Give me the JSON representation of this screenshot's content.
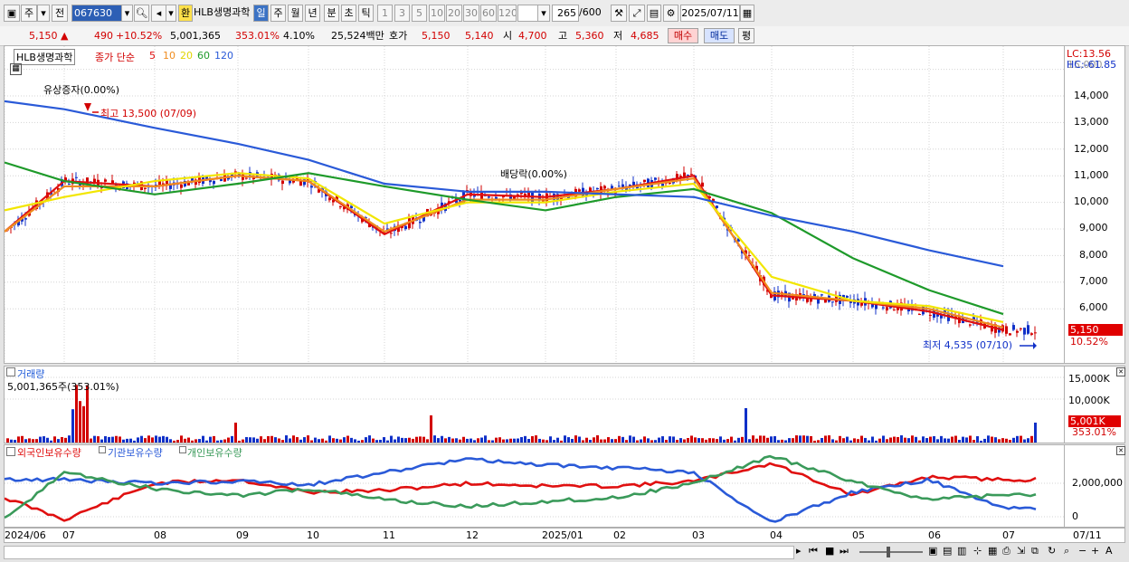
{
  "toolbar": {
    "period_tabs": [
      "주",
      "전"
    ],
    "stock_code": "067630",
    "exchange_badge": "환",
    "stock_name": "HLB생명과학",
    "interval_tabs": [
      "일",
      "주",
      "월",
      "년",
      "분",
      "초",
      "틱"
    ],
    "active_interval": "일",
    "minute_options": [
      "1",
      "3",
      "5",
      "10",
      "20",
      "30",
      "60",
      "120"
    ],
    "count": "265",
    "count_max": "/600",
    "date": "2025/07/11"
  },
  "quote": {
    "price": "5,150",
    "change": "490",
    "change_pct": "+10.52%",
    "volume": "5,001,365",
    "volume_ratio": "353.01%",
    "turnover": "4.10%",
    "amount": "25,524백만",
    "bid_label": "호가",
    "ask": "5,150",
    "bid": "5,140",
    "open_label": "시",
    "open": "4,700",
    "high_label": "고",
    "high": "5,360",
    "low_label": "저",
    "low": "4,685",
    "buy_label": "매수",
    "sell_label": "매도",
    "avg_label": "평"
  },
  "price_panel": {
    "legend_name": "HLB생명과학",
    "legend_type": "종가 단순",
    "ma_labels": [
      "5",
      "10",
      "20",
      "60",
      "120"
    ],
    "lc_label": "LC:13.56",
    "hc_label": "HC:-61.85",
    "y_ticks": [
      "14,000",
      "13,000",
      "12,000",
      "11,000",
      "10,000",
      "9,000",
      "8,000",
      "7,000",
      "6,000"
    ],
    "y_top_tick": "15,000",
    "current_price_tag": "5,150",
    "current_pct_tag": "10.52%",
    "annot_rights": "유상증자(0.00%)",
    "annot_high": "최고 13,500 (07/09)",
    "annot_dividend": "배당락(0.00%)",
    "annot_low": "최저 4,535 (07/10)"
  },
  "volume_panel": {
    "title": "거래량",
    "value_line": "5,001,365주(353.01%)",
    "y_ticks": [
      "15,000K",
      "10,000K"
    ],
    "current_tag": "5,001K",
    "current_pct": "353.01%"
  },
  "investor_panel": {
    "legend": [
      "외국인보유수량",
      "기관보유수량",
      "개인보유수량"
    ],
    "y_ticks": [
      "2,000,000",
      "0"
    ]
  },
  "x_axis": {
    "labels": [
      "2024/06",
      "07",
      "08",
      "09",
      "10",
      "11",
      "12",
      "2025/01",
      "02",
      "03",
      "04",
      "05",
      "06",
      "07"
    ],
    "right_label": "07/11"
  },
  "colors": {
    "up": "#d20000",
    "down": "#1030c8",
    "ma5": "#e01010",
    "ma10": "#f08c1e",
    "ma20": "#f2e600",
    "ma60": "#1e9a2a",
    "ma120": "#2a5ad8",
    "foreign": "#e01010",
    "institution": "#2a5ad8",
    "individual": "#3a9a5a"
  },
  "chart_data": {
    "type": "line",
    "title": "HLB생명과학",
    "x": [
      "2024/06",
      "07",
      "08",
      "09",
      "10",
      "11",
      "12",
      "2025/01",
      "02",
      "03",
      "04",
      "05",
      "06",
      "07"
    ],
    "ylim": [
      4500,
      15000
    ],
    "series": [
      {
        "name": "5",
        "values": [
          8900,
          10800,
          10600,
          11000,
          10800,
          8800,
          10300,
          10200,
          10500,
          11000,
          6500,
          6300,
          5900,
          5200
        ]
      },
      {
        "name": "10",
        "values": [
          8900,
          10600,
          10600,
          11000,
          10800,
          8900,
          10100,
          10100,
          10500,
          10900,
          6600,
          6300,
          6000,
          5300
        ]
      },
      {
        "name": "20",
        "values": [
          9700,
          10200,
          10800,
          11100,
          10900,
          9200,
          10000,
          10000,
          10400,
          10700,
          7200,
          6300,
          6100,
          5500
        ]
      },
      {
        "name": "60",
        "values": [
          11500,
          10800,
          10300,
          10700,
          11100,
          10600,
          10100,
          9700,
          10200,
          10500,
          9600,
          7900,
          6700,
          5800
        ]
      },
      {
        "name": "120",
        "values": [
          13800,
          13500,
          12800,
          12200,
          11600,
          10700,
          10400,
          10400,
          10300,
          10200,
          9500,
          8900,
          8200,
          7600
        ]
      }
    ]
  }
}
